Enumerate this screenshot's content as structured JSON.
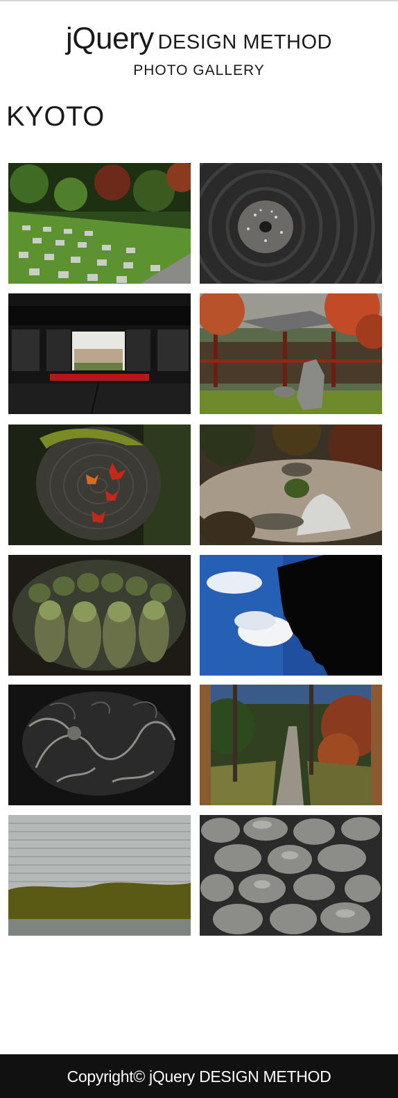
{
  "header": {
    "brand": "jQuery",
    "title_rest": "DESIGN METHOD",
    "subtitle": "PHOTO GALLERY"
  },
  "section": {
    "title": "KYOTO"
  },
  "gallery": {
    "photos": [
      {
        "subject": "moss checkerboard garden"
      },
      {
        "subject": "raked sand with stone"
      },
      {
        "subject": "temple interior view"
      },
      {
        "subject": "pavilion with autumn maples"
      },
      {
        "subject": "stump with red maple leaves"
      },
      {
        "subject": "dry garden with sand cone"
      },
      {
        "subject": "mossy stone statues"
      },
      {
        "subject": "sky and roof eaves"
      },
      {
        "subject": "dragon ceiling painting"
      },
      {
        "subject": "stone garden path"
      },
      {
        "subject": "raked gravel and moss"
      },
      {
        "subject": "stone wall"
      }
    ]
  },
  "footer": {
    "copyright": "Copyright© jQuery DESIGN METHOD"
  }
}
